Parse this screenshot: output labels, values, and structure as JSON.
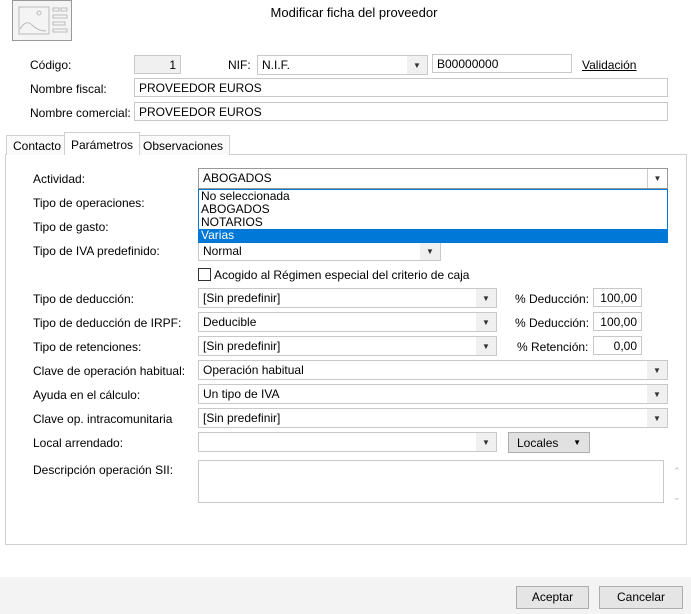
{
  "window": {
    "title": "Modificar ficha del proveedor",
    "logo_icon": "image-card-icon"
  },
  "header": {
    "codigo_label": "Código:",
    "codigo_value": "1",
    "nif_label": "NIF:",
    "nif_type": "N.I.F.",
    "nif_value": "B00000000",
    "validacion_link": "Validación",
    "nombre_fiscal_label": "Nombre fiscal:",
    "nombre_fiscal_value": "PROVEEDOR EUROS",
    "nombre_comercial_label": "Nombre comercial:",
    "nombre_comercial_value": "PROVEEDOR EUROS"
  },
  "tabs": [
    {
      "label": "Contacto"
    },
    {
      "label": "Parámetros",
      "selected": true
    },
    {
      "label": "Observaciones"
    }
  ],
  "params": {
    "actividad_label": "Actividad:",
    "actividad_value": "ABOGADOS",
    "actividad_options": [
      "No seleccionada",
      "ABOGADOS",
      "NOTARIOS",
      "Varias"
    ],
    "actividad_highlighted": "Varias",
    "tipo_operaciones_label": "Tipo de operaciones:",
    "tipo_gasto_label": "Tipo de gasto:",
    "tipo_iva_label": "Tipo de IVA predefinido:",
    "tipo_iva_value": "Normal",
    "criterio_caja_label": "Acogido al Régimen especial del criterio de caja",
    "criterio_caja_checked": false,
    "tipo_deduccion_label": "Tipo de deducción:",
    "tipo_deduccion_value": "[Sin predefinir]",
    "pct_deduccion_label": "% Deducción:",
    "pct_deduccion_value": "100,00",
    "tipo_deduccion_irpf_label": "Tipo de deducción de IRPF:",
    "tipo_deduccion_irpf_value": "Deducible",
    "pct_deduccion_irpf_label": "% Deducción:",
    "pct_deduccion_irpf_value": "100,00",
    "tipo_retenciones_label": "Tipo de retenciones:",
    "tipo_retenciones_value": "[Sin predefinir]",
    "pct_retencion_label": "% Retención:",
    "pct_retencion_value": "0,00",
    "clave_op_label": "Clave de operación habitual:",
    "clave_op_value": "Operación habitual",
    "ayuda_label": "Ayuda en el cálculo:",
    "ayuda_value": "Un tipo de IVA",
    "clave_intra_label": "Clave op. intracomunitaria",
    "clave_intra_value": "[Sin predefinir]",
    "local_label": "Local arrendado:",
    "local_value": "",
    "locales_button": "Locales",
    "descripcion_label": "Descripción operación SII:",
    "descripcion_value": ""
  },
  "footer": {
    "accept": "Aceptar",
    "cancel": "Cancelar"
  },
  "colors": {
    "highlight": "#0078d7",
    "footer_bg": "#f3f3f3"
  }
}
